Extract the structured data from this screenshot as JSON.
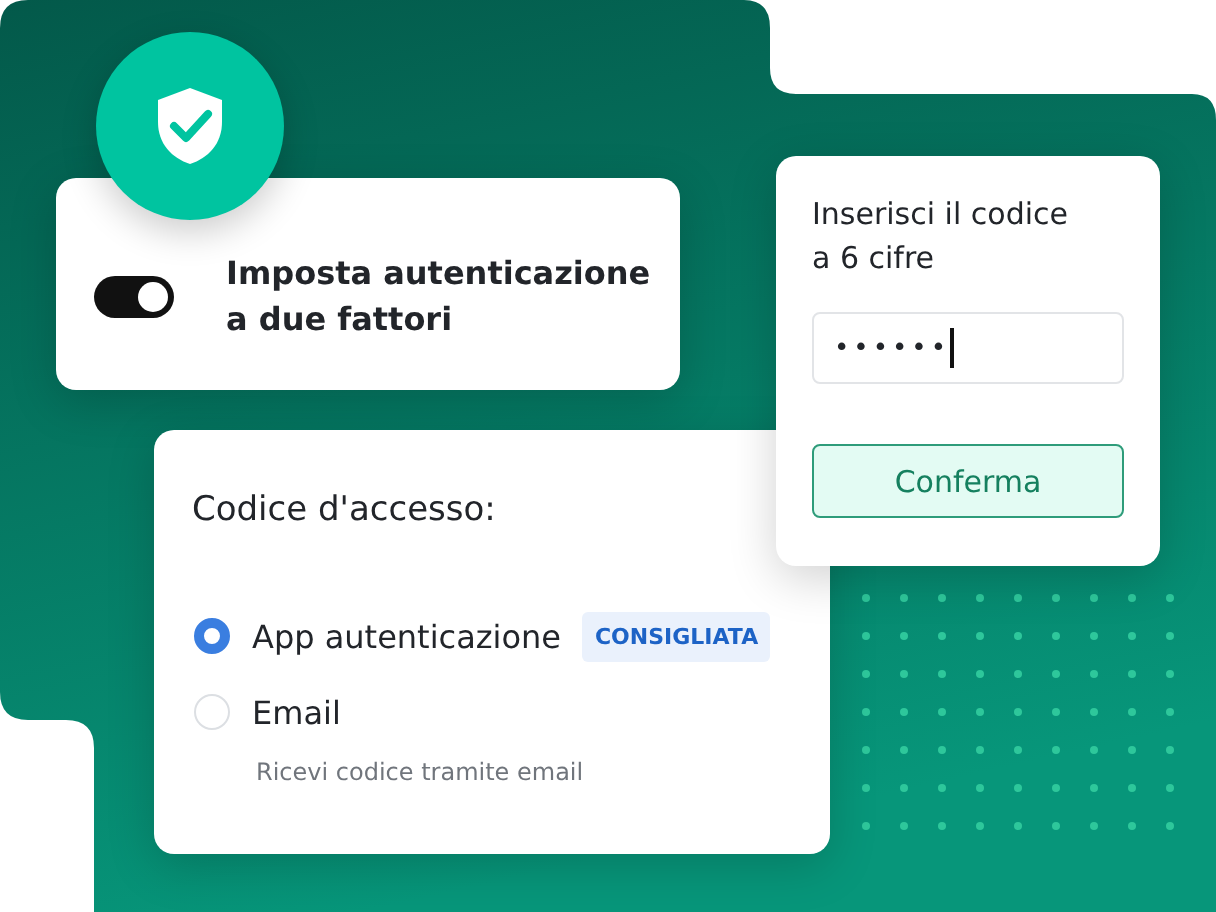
{
  "toggle_card": {
    "toggle_on": true,
    "label": "Imposta autenticazione a due fattori"
  },
  "code_card": {
    "prompt": "Inserisci il codice a 6 cifre",
    "code_field": {
      "value": "••••••"
    },
    "confirm_button": "Conferma"
  },
  "access_card": {
    "title": "Codice d'accesso:",
    "options": [
      {
        "label": "App autenticazione",
        "selected": true,
        "badge": "CONSIGLIATA"
      },
      {
        "label": "Email",
        "selected": false,
        "description": "Ricevi codice tramite email"
      }
    ]
  }
}
